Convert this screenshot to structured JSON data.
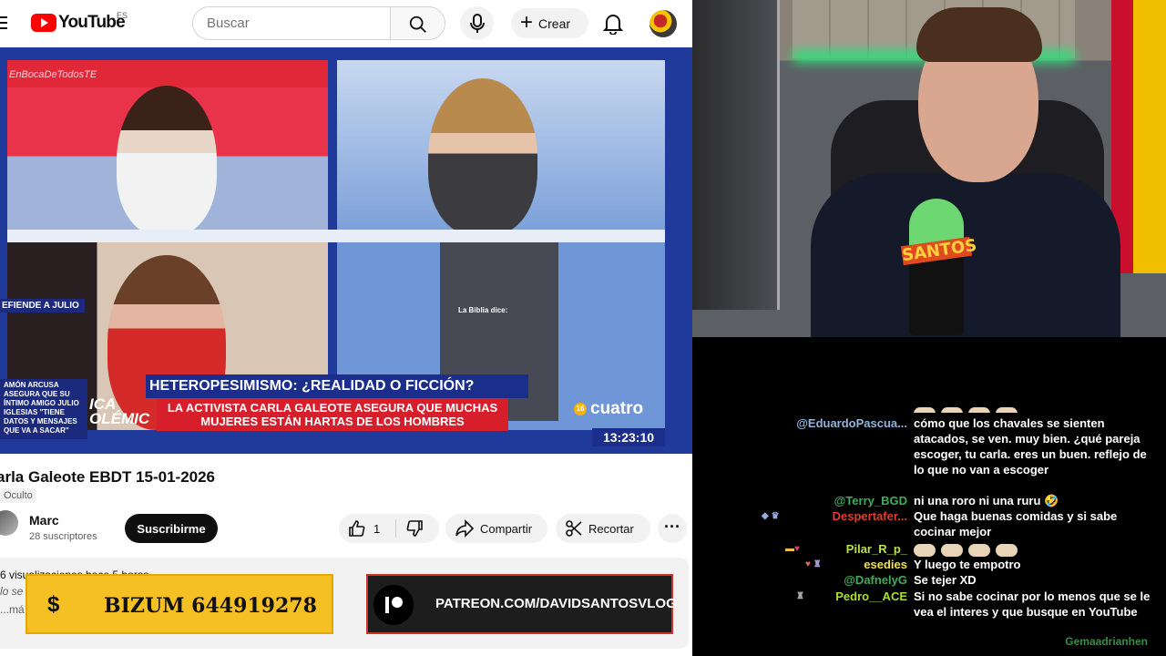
{
  "youtube": {
    "logo_text": "YouTube",
    "logo_country": "ES",
    "search_placeholder": "Buscar",
    "create_label": "Crear",
    "video": {
      "watermark": "EnBocaDeTodosTE",
      "defiende_label": "EFIENDE A JULIO",
      "side_caption": "AMÓN ARCUSA\nASEGURA QUE SU\nÍNTIMO AMIGO JULIO\nIGLESIAS \"TIENE\nDATOS Y MENSAJES\nQUE VA A SACAR\"",
      "side_word": "ICA\nOLÉMIC",
      "headline": "HETEROPESIMISMO: ¿REALIDAD O FICCIÓN?",
      "subline": "LA ACTIVISTA CARLA GALEOTE ASEGURA QUE MUCHAS MUJERES ESTÁN HARTAS DE LOS HOMBRES",
      "clip_caption": "La Biblia dice:",
      "channel_logo": "cuatro",
      "age_rating": "16",
      "clock": "13:23:10"
    },
    "title": "arla Galeote EBDT 15-01-2026",
    "visibility": "Oculto",
    "channel_name": "Marc",
    "subscribers": "28 suscriptores",
    "subscribe_label": "Suscribirme",
    "like_count": "1",
    "share_label": "Compartir",
    "clip_label": "Recortar",
    "more_label": "···",
    "desc_stats": "6 visualizaciones  hace 5 horas",
    "desc_line": "lo se",
    "desc_more": "...má"
  },
  "overlays": {
    "bizum_symbol": "$",
    "bizum_text": "BIZUM 644919278",
    "patreon_text": "PATREON.COM/DAVIDSANTOSVLOG"
  },
  "webcam": {
    "mic_brand": "SANTOS"
  },
  "chat": {
    "messages": [
      {
        "user": "@EduardoPascua...",
        "color": "#8fb4d9",
        "text": "cómo que los chavales se sienten atacados, se ven. muy bien. ¿qué pareja escoger, tu carla. eres un buen. reflejo de lo que no van a escoger"
      },
      {
        "user": "@Terry_BGD",
        "color": "#3fae5a",
        "text": "ni una roro ni una ruru 🤣"
      },
      {
        "user": "Despertafer...",
        "color": "#e63b2e",
        "text": "Que haga buenas comidas y si sabe cocinar mejor"
      },
      {
        "user": "Pilar_R_p_",
        "color": "#b8e04a",
        "text": ""
      },
      {
        "user": "esedies",
        "color": "#f0e14a",
        "text": "Y luego te empotro"
      },
      {
        "user": "@DafnelyG",
        "color": "#3fae5a",
        "text": "Se tejer XD"
      },
      {
        "user": "Pedro__ACE",
        "color": "#a8e02a",
        "text": "Si no sabe cocinar por lo menos que se le vea el interes y que busque en YouTube"
      }
    ],
    "footer_user": "Gemaadrianhen"
  }
}
